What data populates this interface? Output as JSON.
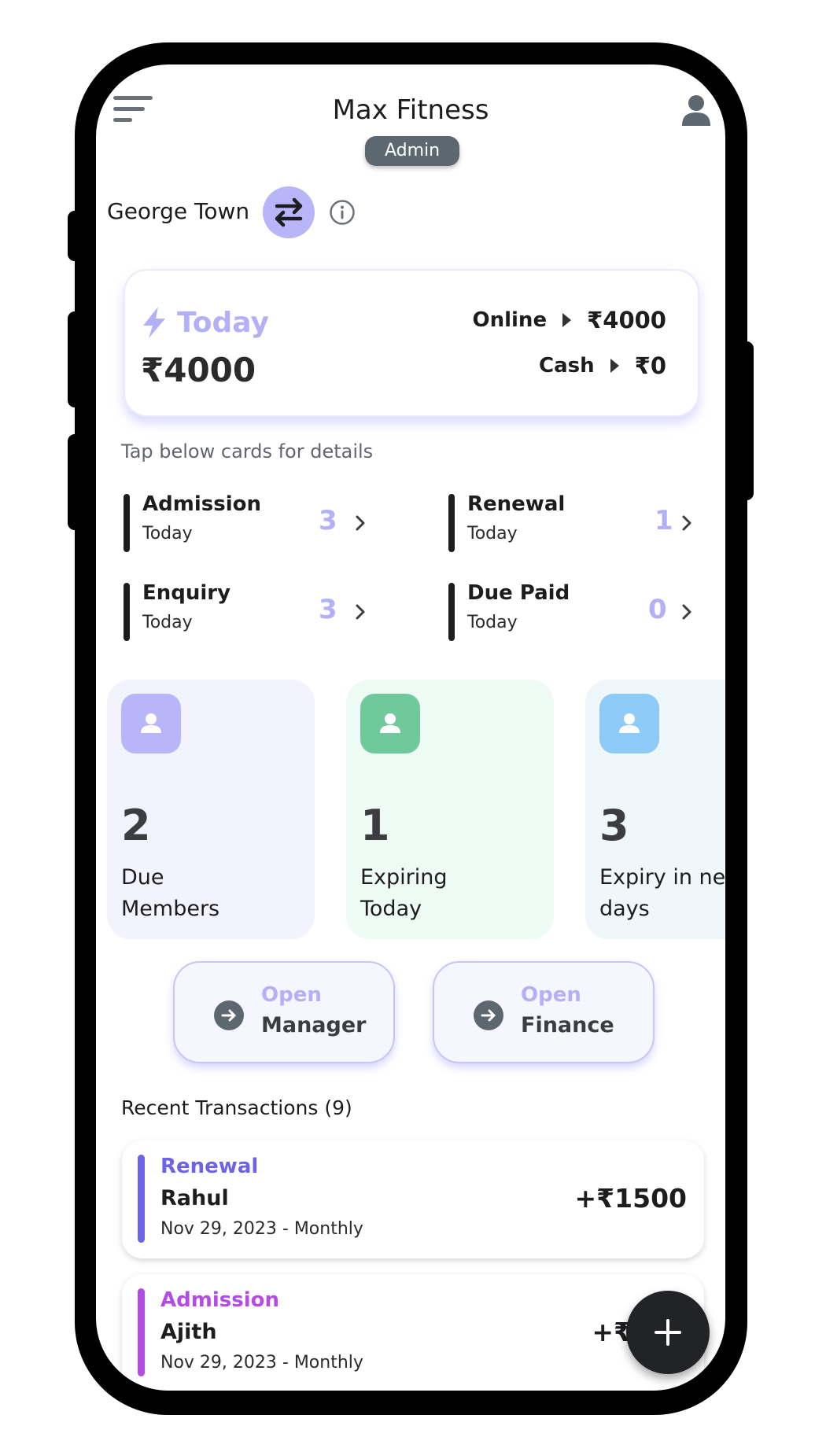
{
  "header": {
    "title": "Max Fitness",
    "role_badge": "Admin"
  },
  "location": {
    "name": "George Town"
  },
  "today_card": {
    "label": "Today",
    "total": "₹4000",
    "online_label": "Online",
    "online_amount": "₹4000",
    "cash_label": "Cash",
    "cash_amount": "₹0"
  },
  "tap_hint": "Tap below cards for details",
  "stats": [
    {
      "name": "Admission",
      "sub": "Today",
      "count": "3"
    },
    {
      "name": "Renewal",
      "sub": "Today",
      "count": "1"
    },
    {
      "name": "Enquiry",
      "sub": "Today",
      "count": "3"
    },
    {
      "name": "Due Paid",
      "sub": "Today",
      "count": "0"
    }
  ],
  "member_cards": [
    {
      "count": "2",
      "line1": "Due",
      "line2": "Members",
      "icon": "member-icon",
      "bg": "#f3f3fd",
      "icon_bg": "#b8b5f9"
    },
    {
      "count": "1",
      "line1": "Expiring",
      "line2": "Today",
      "icon": "member-icon",
      "bg": "#eefaf4",
      "icon_bg": "#6fc99b"
    },
    {
      "count": "3",
      "line1": "Expiry in next",
      "line2": "days",
      "icon": "member-icon",
      "bg": "#eff7fb",
      "icon_bg": "#8ecaf6"
    }
  ],
  "open_buttons": [
    {
      "line1": "Open",
      "line2": "Manager"
    },
    {
      "line1": "Open",
      "line2": "Finance"
    }
  ],
  "recent": {
    "title": "Recent Transactions (9)",
    "items": [
      {
        "type": "Renewal",
        "name": "Rahul",
        "date": "Nov 29, 2023 - Monthly",
        "amount": "+₹1500",
        "color": "#6c63e6"
      },
      {
        "type": "Admission",
        "name": "Ajith",
        "date": "Nov 29, 2023 - Monthly",
        "amount": "+₹",
        "color": "#b44be5"
      }
    ]
  },
  "colors": {
    "accent": "#b3b0f7",
    "frame": "#000000"
  }
}
